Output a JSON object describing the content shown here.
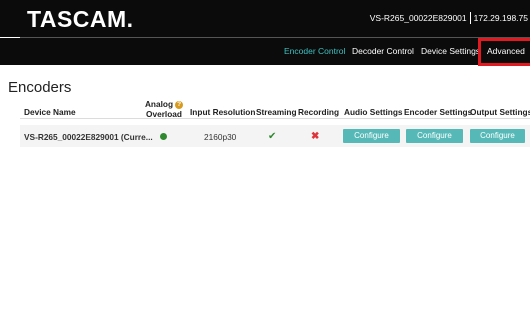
{
  "header": {
    "logo": "TASCAM",
    "device_name": "VS-R265_00022E829001",
    "ip_address": "172.29.198.75"
  },
  "nav": {
    "items": [
      {
        "label": "Encoder Control",
        "active": true
      },
      {
        "label": "Decoder Control",
        "active": false
      },
      {
        "label": "Device Settings",
        "active": false
      },
      {
        "label": "Advanced",
        "active": false,
        "highlighted": true
      }
    ]
  },
  "main": {
    "title": "Encoders",
    "columns": [
      "Device Name",
      "Analog Overload",
      "Input Resolution",
      "Streaming",
      "Recording",
      "Audio Settings",
      "Encoder Settings",
      "Output Settings"
    ],
    "rows": [
      {
        "device_name": "VS-R265_00022E829001 (Curre...",
        "analog_overload_icon": "green-dot-icon",
        "input_resolution": "2160p30",
        "streaming_icon": "check-icon",
        "recording_icon": "cross-icon",
        "audio_settings_button": "Configure",
        "encoder_settings_button": "Configure",
        "output_settings_button": "Configure"
      }
    ]
  },
  "colors": {
    "topbar_bg": "#0b0b0b",
    "nav_active": "#3fc0c0",
    "highlight_border": "#e11a22",
    "button_bg": "#56b9b7",
    "ok_green": "#2f8a2f",
    "error_red": "#e0343c",
    "help_icon": "#d79b1f"
  }
}
